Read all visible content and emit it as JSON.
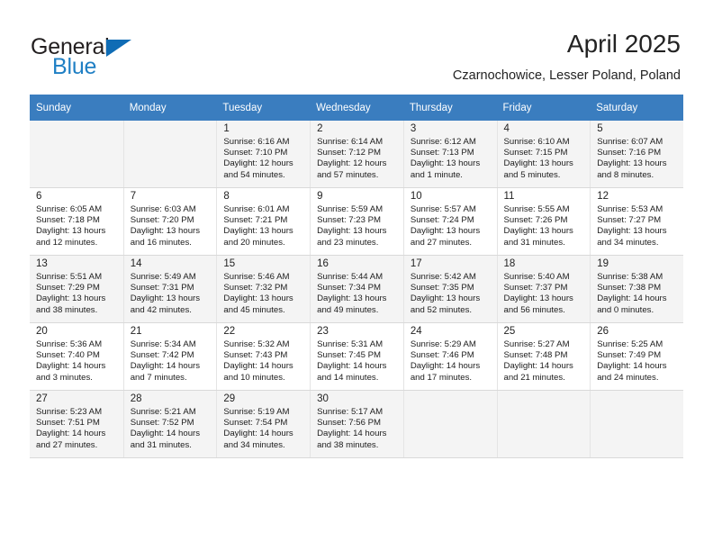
{
  "brand": {
    "name_top": "General",
    "name_bottom": "Blue",
    "accent_color": "#0f6cb5",
    "triangle_icon": "triangle-icon"
  },
  "header": {
    "title": "April 2025",
    "subtitle": "Czarnochowice, Lesser Poland, Poland"
  },
  "calendar": {
    "header_bg": "#3a7dbf",
    "weekdays": [
      "Sunday",
      "Monday",
      "Tuesday",
      "Wednesday",
      "Thursday",
      "Friday",
      "Saturday"
    ],
    "weeks": [
      [
        {
          "day": "",
          "sunrise": "",
          "sunset": "",
          "daylight1": "",
          "daylight2": ""
        },
        {
          "day": "",
          "sunrise": "",
          "sunset": "",
          "daylight1": "",
          "daylight2": ""
        },
        {
          "day": "1",
          "sunrise": "Sunrise: 6:16 AM",
          "sunset": "Sunset: 7:10 PM",
          "daylight1": "Daylight: 12 hours",
          "daylight2": "and 54 minutes."
        },
        {
          "day": "2",
          "sunrise": "Sunrise: 6:14 AM",
          "sunset": "Sunset: 7:12 PM",
          "daylight1": "Daylight: 12 hours",
          "daylight2": "and 57 minutes."
        },
        {
          "day": "3",
          "sunrise": "Sunrise: 6:12 AM",
          "sunset": "Sunset: 7:13 PM",
          "daylight1": "Daylight: 13 hours",
          "daylight2": "and 1 minute."
        },
        {
          "day": "4",
          "sunrise": "Sunrise: 6:10 AM",
          "sunset": "Sunset: 7:15 PM",
          "daylight1": "Daylight: 13 hours",
          "daylight2": "and 5 minutes."
        },
        {
          "day": "5",
          "sunrise": "Sunrise: 6:07 AM",
          "sunset": "Sunset: 7:16 PM",
          "daylight1": "Daylight: 13 hours",
          "daylight2": "and 8 minutes."
        }
      ],
      [
        {
          "day": "6",
          "sunrise": "Sunrise: 6:05 AM",
          "sunset": "Sunset: 7:18 PM",
          "daylight1": "Daylight: 13 hours",
          "daylight2": "and 12 minutes."
        },
        {
          "day": "7",
          "sunrise": "Sunrise: 6:03 AM",
          "sunset": "Sunset: 7:20 PM",
          "daylight1": "Daylight: 13 hours",
          "daylight2": "and 16 minutes."
        },
        {
          "day": "8",
          "sunrise": "Sunrise: 6:01 AM",
          "sunset": "Sunset: 7:21 PM",
          "daylight1": "Daylight: 13 hours",
          "daylight2": "and 20 minutes."
        },
        {
          "day": "9",
          "sunrise": "Sunrise: 5:59 AM",
          "sunset": "Sunset: 7:23 PM",
          "daylight1": "Daylight: 13 hours",
          "daylight2": "and 23 minutes."
        },
        {
          "day": "10",
          "sunrise": "Sunrise: 5:57 AM",
          "sunset": "Sunset: 7:24 PM",
          "daylight1": "Daylight: 13 hours",
          "daylight2": "and 27 minutes."
        },
        {
          "day": "11",
          "sunrise": "Sunrise: 5:55 AM",
          "sunset": "Sunset: 7:26 PM",
          "daylight1": "Daylight: 13 hours",
          "daylight2": "and 31 minutes."
        },
        {
          "day": "12",
          "sunrise": "Sunrise: 5:53 AM",
          "sunset": "Sunset: 7:27 PM",
          "daylight1": "Daylight: 13 hours",
          "daylight2": "and 34 minutes."
        }
      ],
      [
        {
          "day": "13",
          "sunrise": "Sunrise: 5:51 AM",
          "sunset": "Sunset: 7:29 PM",
          "daylight1": "Daylight: 13 hours",
          "daylight2": "and 38 minutes."
        },
        {
          "day": "14",
          "sunrise": "Sunrise: 5:49 AM",
          "sunset": "Sunset: 7:31 PM",
          "daylight1": "Daylight: 13 hours",
          "daylight2": "and 42 minutes."
        },
        {
          "day": "15",
          "sunrise": "Sunrise: 5:46 AM",
          "sunset": "Sunset: 7:32 PM",
          "daylight1": "Daylight: 13 hours",
          "daylight2": "and 45 minutes."
        },
        {
          "day": "16",
          "sunrise": "Sunrise: 5:44 AM",
          "sunset": "Sunset: 7:34 PM",
          "daylight1": "Daylight: 13 hours",
          "daylight2": "and 49 minutes."
        },
        {
          "day": "17",
          "sunrise": "Sunrise: 5:42 AM",
          "sunset": "Sunset: 7:35 PM",
          "daylight1": "Daylight: 13 hours",
          "daylight2": "and 52 minutes."
        },
        {
          "day": "18",
          "sunrise": "Sunrise: 5:40 AM",
          "sunset": "Sunset: 7:37 PM",
          "daylight1": "Daylight: 13 hours",
          "daylight2": "and 56 minutes."
        },
        {
          "day": "19",
          "sunrise": "Sunrise: 5:38 AM",
          "sunset": "Sunset: 7:38 PM",
          "daylight1": "Daylight: 14 hours",
          "daylight2": "and 0 minutes."
        }
      ],
      [
        {
          "day": "20",
          "sunrise": "Sunrise: 5:36 AM",
          "sunset": "Sunset: 7:40 PM",
          "daylight1": "Daylight: 14 hours",
          "daylight2": "and 3 minutes."
        },
        {
          "day": "21",
          "sunrise": "Sunrise: 5:34 AM",
          "sunset": "Sunset: 7:42 PM",
          "daylight1": "Daylight: 14 hours",
          "daylight2": "and 7 minutes."
        },
        {
          "day": "22",
          "sunrise": "Sunrise: 5:32 AM",
          "sunset": "Sunset: 7:43 PM",
          "daylight1": "Daylight: 14 hours",
          "daylight2": "and 10 minutes."
        },
        {
          "day": "23",
          "sunrise": "Sunrise: 5:31 AM",
          "sunset": "Sunset: 7:45 PM",
          "daylight1": "Daylight: 14 hours",
          "daylight2": "and 14 minutes."
        },
        {
          "day": "24",
          "sunrise": "Sunrise: 5:29 AM",
          "sunset": "Sunset: 7:46 PM",
          "daylight1": "Daylight: 14 hours",
          "daylight2": "and 17 minutes."
        },
        {
          "day": "25",
          "sunrise": "Sunrise: 5:27 AM",
          "sunset": "Sunset: 7:48 PM",
          "daylight1": "Daylight: 14 hours",
          "daylight2": "and 21 minutes."
        },
        {
          "day": "26",
          "sunrise": "Sunrise: 5:25 AM",
          "sunset": "Sunset: 7:49 PM",
          "daylight1": "Daylight: 14 hours",
          "daylight2": "and 24 minutes."
        }
      ],
      [
        {
          "day": "27",
          "sunrise": "Sunrise: 5:23 AM",
          "sunset": "Sunset: 7:51 PM",
          "daylight1": "Daylight: 14 hours",
          "daylight2": "and 27 minutes."
        },
        {
          "day": "28",
          "sunrise": "Sunrise: 5:21 AM",
          "sunset": "Sunset: 7:52 PM",
          "daylight1": "Daylight: 14 hours",
          "daylight2": "and 31 minutes."
        },
        {
          "day": "29",
          "sunrise": "Sunrise: 5:19 AM",
          "sunset": "Sunset: 7:54 PM",
          "daylight1": "Daylight: 14 hours",
          "daylight2": "and 34 minutes."
        },
        {
          "day": "30",
          "sunrise": "Sunrise: 5:17 AM",
          "sunset": "Sunset: 7:56 PM",
          "daylight1": "Daylight: 14 hours",
          "daylight2": "and 38 minutes."
        },
        {
          "day": "",
          "sunrise": "",
          "sunset": "",
          "daylight1": "",
          "daylight2": ""
        },
        {
          "day": "",
          "sunrise": "",
          "sunset": "",
          "daylight1": "",
          "daylight2": ""
        },
        {
          "day": "",
          "sunrise": "",
          "sunset": "",
          "daylight1": "",
          "daylight2": ""
        }
      ]
    ]
  }
}
